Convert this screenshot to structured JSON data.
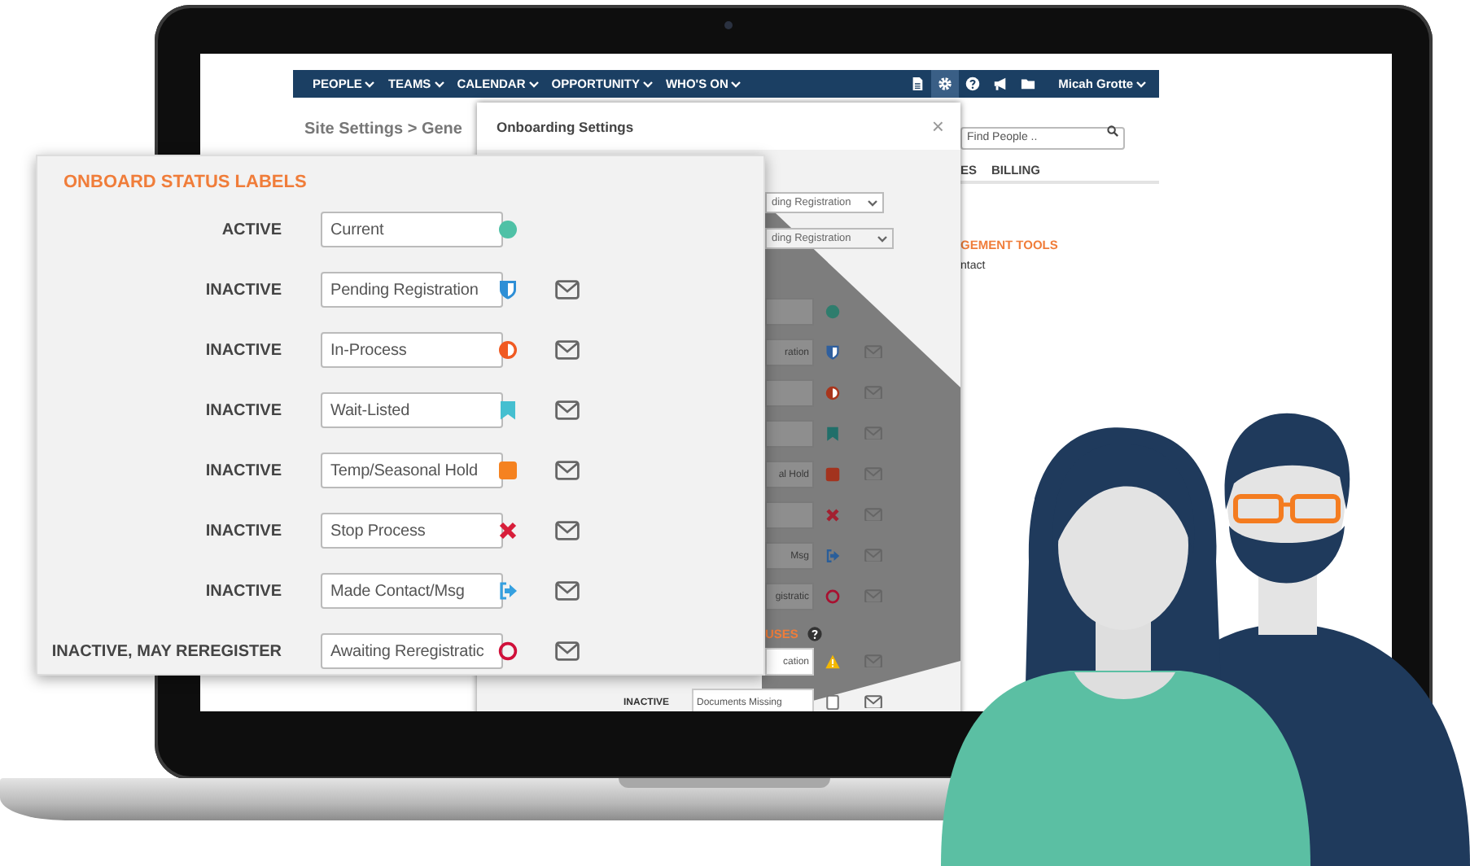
{
  "navbar": {
    "menus": [
      "PEOPLE",
      "TEAMS",
      "CALENDAR",
      "OPPORTUNITY",
      "WHO'S ON"
    ],
    "tools": [
      {
        "kind": "document",
        "selected": false
      },
      {
        "kind": "gear",
        "selected": true
      },
      {
        "kind": "help",
        "selected": false
      },
      {
        "kind": "megaphone",
        "selected": false
      },
      {
        "kind": "folder",
        "selected": false
      }
    ],
    "user": "Micah Grotte"
  },
  "page": {
    "breadcrumb": "Site Settings > Gene",
    "search": {
      "placeholder": "Find People .."
    },
    "tabs": [
      "ES",
      "BILLING"
    ],
    "section_title": "GEMENT TOOLS",
    "link": "ntact"
  },
  "modal": {
    "title": "Onboarding Settings",
    "close": "×",
    "dropdowns": [
      "ding Registration",
      "ding Registration"
    ],
    "rows": [
      {
        "kind": "dot",
        "color": "#2f7d6d",
        "mail": false
      },
      {
        "value": "ration",
        "kind": "shield",
        "color": "#2f5f9e",
        "mail": true
      },
      {
        "kind": "half-circle",
        "color": "#a8351c",
        "mail": true
      },
      {
        "kind": "bookmark",
        "color": "#216f6a",
        "mail": true
      },
      {
        "value": "al Hold",
        "kind": "square",
        "color": "#a3331e",
        "mail": true
      },
      {
        "kind": "cross",
        "color": "#a32030",
        "mail": true
      },
      {
        "value": "Msg",
        "kind": "exit",
        "color": "#2a5e9a",
        "mail": true
      },
      {
        "value": "gistratic",
        "kind": "ring",
        "color": "#a81030",
        "mail": true
      }
    ],
    "section_title": "USES",
    "more_rows": [
      {
        "value": "cation",
        "kind": "warning",
        "color": "#f5b800",
        "mail": true
      },
      {
        "label": "INACTIVE",
        "value": "Documents Missing",
        "kind": "checkbox",
        "color": "#777777",
        "mail": true
      }
    ]
  },
  "callout": {
    "title": "ONBOARD STATUS LABELS",
    "rows": [
      {
        "status": "ACTIVE",
        "value": "Current",
        "kind": "dot",
        "color": "#4fc1a6",
        "mail": false
      },
      {
        "status": "INACTIVE",
        "value": "Pending Registration",
        "kind": "shield",
        "color": "#2e8fd6",
        "mail": true
      },
      {
        "status": "INACTIVE",
        "value": "In-Process",
        "kind": "half-circle",
        "color": "#f05a22",
        "mail": true
      },
      {
        "status": "INACTIVE",
        "value": "Wait-Listed",
        "kind": "bookmark",
        "color": "#45bfd0",
        "mail": true
      },
      {
        "status": "INACTIVE",
        "value": "Temp/Seasonal Hold",
        "kind": "square",
        "color": "#f58220",
        "mail": true
      },
      {
        "status": "INACTIVE",
        "value": "Stop Process",
        "kind": "cross",
        "color": "#d81e3a",
        "mail": true
      },
      {
        "status": "INACTIVE",
        "value": "Made Contact/Msg",
        "kind": "exit",
        "color": "#35a0e0",
        "mail": true
      },
      {
        "status": "INACTIVE, MAY REREGISTER",
        "value": "Awaiting Reregistratic",
        "kind": "ring",
        "color": "#d0103a",
        "mail": true
      }
    ]
  }
}
